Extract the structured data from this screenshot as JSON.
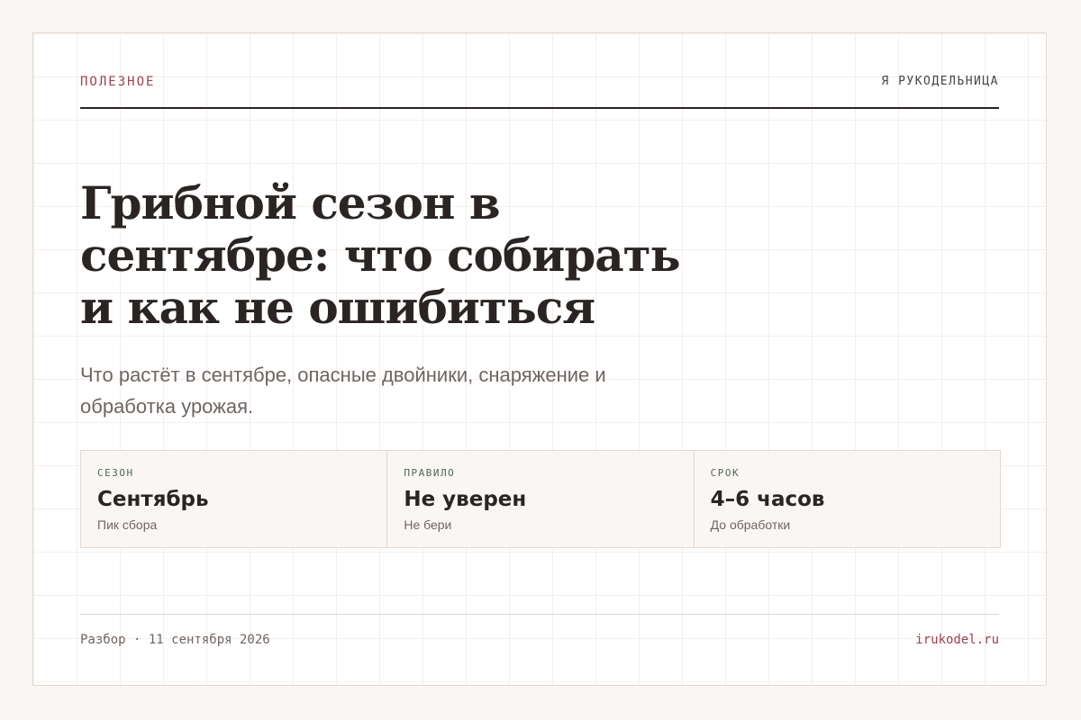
{
  "header": {
    "section": "ПОЛЕЗНОЕ",
    "site": "Я РУКОДЕЛЬНИЦА"
  },
  "article": {
    "title": "Грибной сезон в сентябре: что собирать и как не ошибиться",
    "subtitle": "Что растёт в сентябре, опасные двойники, снаряжение и обработка урожая."
  },
  "facts": [
    {
      "label": "СЕЗОН",
      "value": "Сентябрь",
      "note": "Пик сбора"
    },
    {
      "label": "ПРАВИЛО",
      "value": "Не уверен",
      "note": "Не бери"
    },
    {
      "label": "СРОК",
      "value": "4–6 часов",
      "note": "До обработки"
    }
  ],
  "footer": {
    "meta": "Разбор · 11 сентября 2026",
    "domain": "irukodel.ru"
  },
  "colors": {
    "accent": "#a0404e",
    "label_green": "#4f6b52",
    "text": "#2a2523",
    "muted": "#6f6561",
    "background": "#faf6f3"
  }
}
